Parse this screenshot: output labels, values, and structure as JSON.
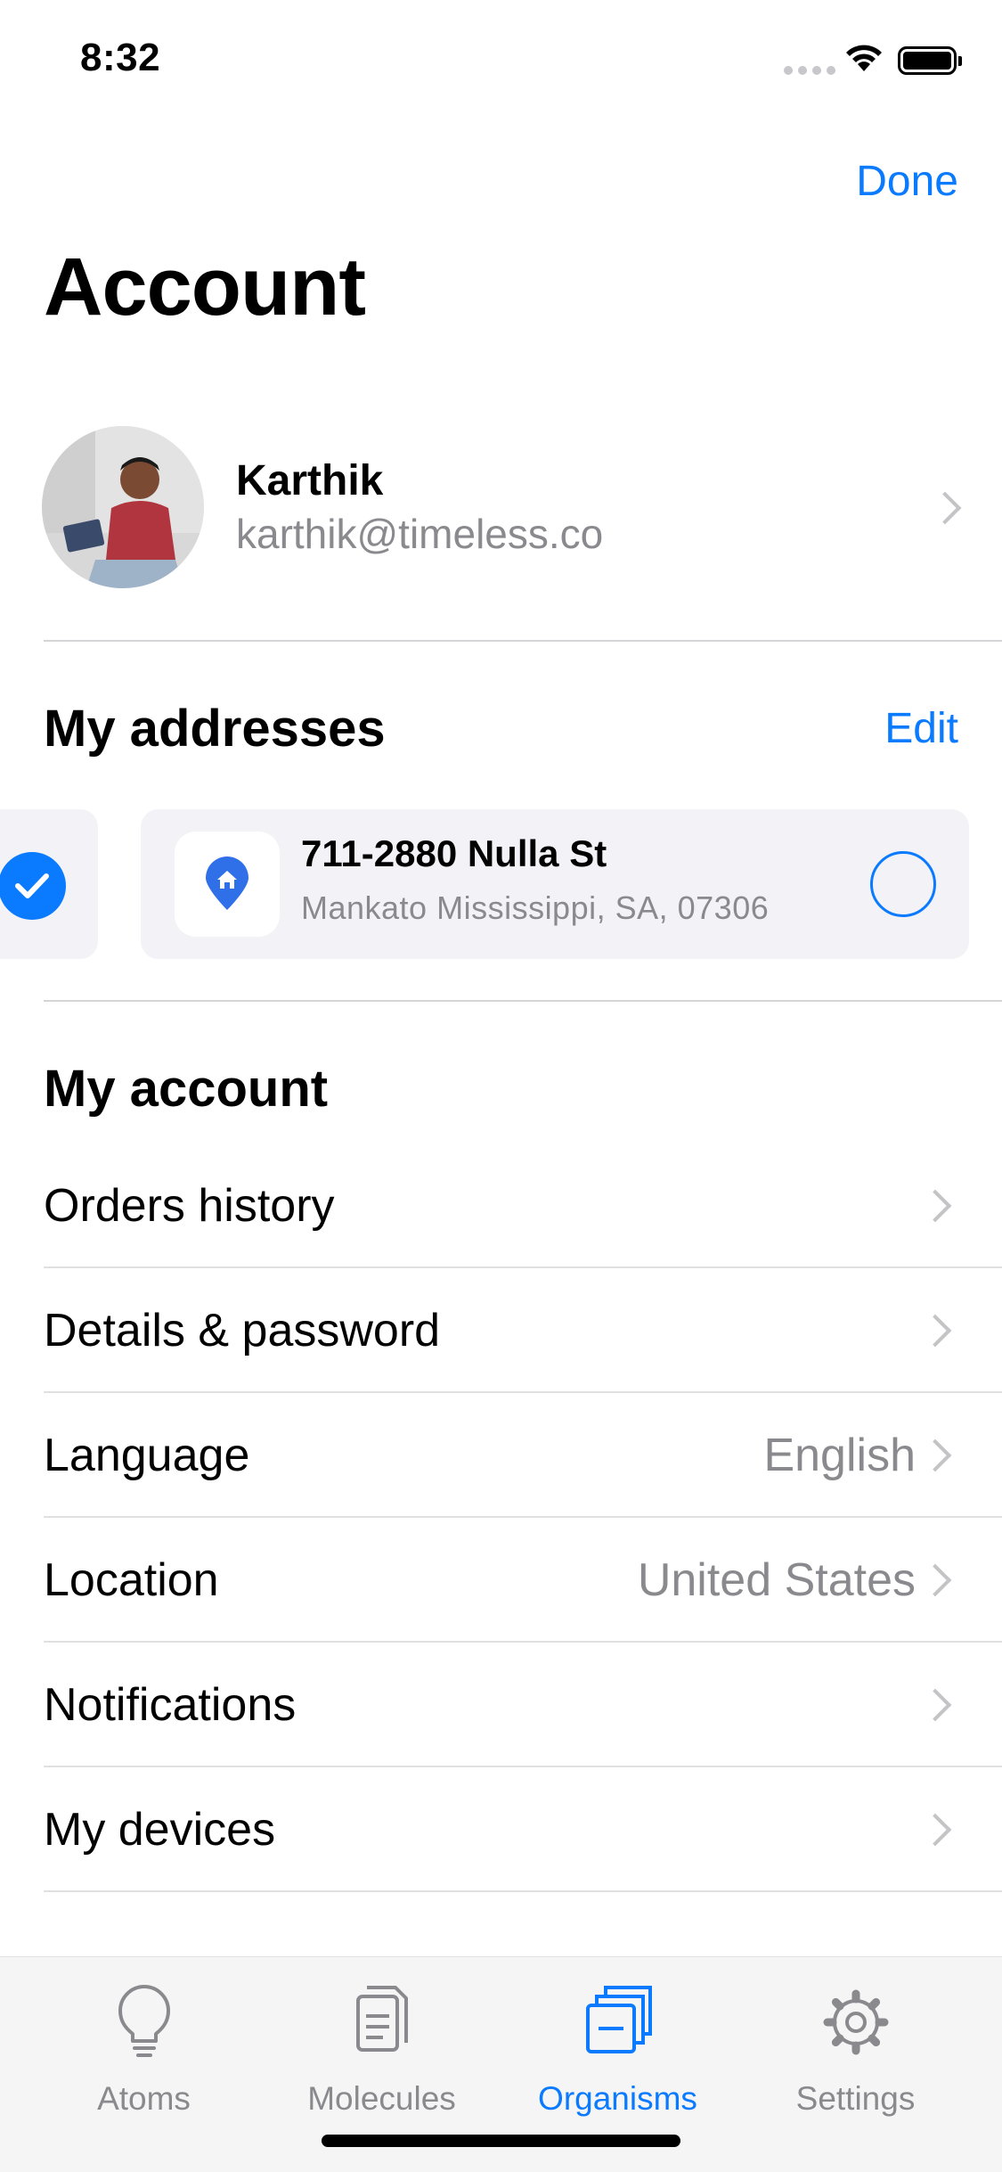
{
  "status_bar": {
    "time": "8:32"
  },
  "nav": {
    "done_label": "Done",
    "title": "Account"
  },
  "profile": {
    "name": "Karthik",
    "email": "karthik@timeless.co"
  },
  "addresses": {
    "title": "My addresses",
    "edit_label": "Edit",
    "items": [
      {
        "street": "711-2880 Nulla St",
        "city": "Mankato Mississippi, SA, 07306",
        "selected": false
      }
    ]
  },
  "account": {
    "title": "My account",
    "items": [
      {
        "label": "Orders history",
        "value": ""
      },
      {
        "label": "Details & password",
        "value": ""
      },
      {
        "label": "Language",
        "value": "English"
      },
      {
        "label": "Location",
        "value": "United States"
      },
      {
        "label": "Notifications",
        "value": ""
      },
      {
        "label": "My devices",
        "value": ""
      }
    ]
  },
  "tabbar": {
    "active": "Organisms",
    "tabs": [
      {
        "label": "Atoms",
        "icon": "lightbulb-icon"
      },
      {
        "label": "Molecules",
        "icon": "document-icon"
      },
      {
        "label": "Organisms",
        "icon": "stacked-squares-icon"
      },
      {
        "label": "Settings",
        "icon": "gear-icon"
      }
    ]
  },
  "colors": {
    "accent": "#0a7aff",
    "secondary_text": "#8a8a8e",
    "card_bg": "#f2f2f7"
  }
}
